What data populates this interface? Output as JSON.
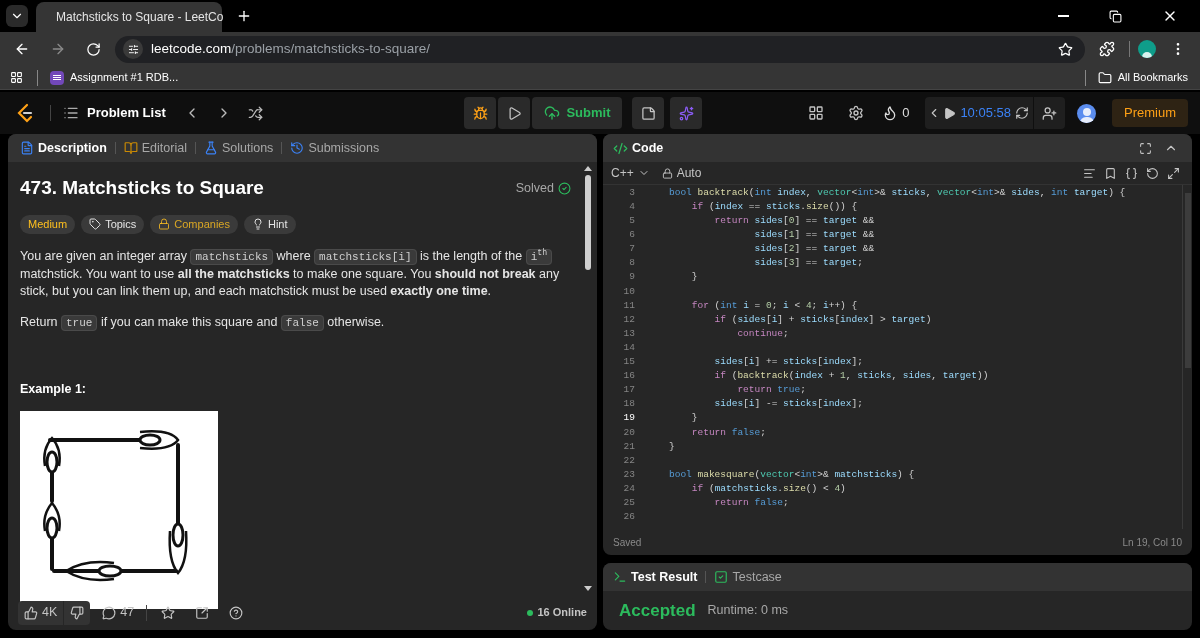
{
  "browser": {
    "tab_title": "Matchsticks to Square - LeetCo",
    "url_host": "leetcode.com",
    "url_path": "/problems/matchsticks-to-square/",
    "bookmarks": [
      "Assignment #1 RDB..."
    ],
    "all_bookmarks": "All Bookmarks"
  },
  "nav": {
    "problem_list": "Problem List",
    "submit": "Submit",
    "streak": "0",
    "timer": "10:05:58",
    "premium": "Premium"
  },
  "description": {
    "tabs": [
      {
        "label": "Description",
        "selected": true
      },
      {
        "label": "Editorial",
        "selected": false
      },
      {
        "label": "Solutions",
        "selected": false
      },
      {
        "label": "Submissions",
        "selected": false
      }
    ],
    "title": "473. Matchsticks to Square",
    "status": "Solved",
    "tags": [
      {
        "kind": "difficulty",
        "label": "Medium"
      },
      {
        "kind": "topics",
        "label": "Topics"
      },
      {
        "kind": "companies",
        "label": "Companies"
      },
      {
        "kind": "hint",
        "label": "Hint"
      }
    ],
    "paragraphs": [
      [
        {
          "kind": "text",
          "text": "You are given an integer array "
        },
        {
          "kind": "code",
          "text": "matchsticks"
        },
        {
          "kind": "text",
          "text": " where "
        },
        {
          "kind": "code",
          "text": "matchsticks[i]"
        },
        {
          "kind": "text",
          "text": " is the length of the "
        },
        {
          "kind": "code",
          "text": "i$^{th}$"
        },
        {
          "kind": "text",
          "text": " matchstick. You want to use **all the matchsticks** to make one square. You **should not break** any stick, but you can link them up, and each matchstick must be used **exactly one time**."
        }
      ],
      [
        {
          "kind": "text",
          "text": "Return "
        },
        {
          "kind": "code",
          "text": "true"
        },
        {
          "kind": "text",
          "text": " if you can make this square and "
        },
        {
          "kind": "code",
          "text": "false"
        },
        {
          "kind": "text",
          "text": " otherwise."
        }
      ]
    ],
    "example_heading": "Example 1:",
    "footer": {
      "likes": "4K",
      "comments": "47",
      "online": "16 Online"
    }
  },
  "editor": {
    "title": "Code",
    "language": "C++",
    "mode": "Auto",
    "saved": "Saved",
    "cursor": "Ln 19, Col 10",
    "lines": [
      {
        "number": "3",
        "current": false,
        "tokens": [
          {
            "kind": "type",
            "text": "bool "
          },
          {
            "kind": "func",
            "text": "backtrack"
          },
          {
            "kind": "plain",
            "text": "("
          },
          {
            "kind": "type",
            "text": "int "
          },
          {
            "kind": "var",
            "text": "index"
          },
          {
            "kind": "plain",
            "text": ", "
          },
          {
            "kind": "class",
            "text": "vector"
          },
          {
            "kind": "plain",
            "text": "<"
          },
          {
            "kind": "type",
            "text": "int"
          },
          {
            "kind": "plain",
            "text": ">& "
          },
          {
            "kind": "var",
            "text": "sticks"
          },
          {
            "kind": "plain",
            "text": ", "
          },
          {
            "kind": "class",
            "text": "vector"
          },
          {
            "kind": "plain",
            "text": "<"
          },
          {
            "kind": "type",
            "text": "int"
          },
          {
            "kind": "plain",
            "text": ">& "
          },
          {
            "kind": "var",
            "text": "sides"
          },
          {
            "kind": "plain",
            "text": ", "
          },
          {
            "kind": "type",
            "text": "int "
          },
          {
            "kind": "var",
            "text": "target"
          },
          {
            "kind": "plain",
            "text": ") {"
          }
        ]
      },
      {
        "number": "4",
        "current": false,
        "tokens": [
          {
            "kind": "keyword",
            "text": "    if"
          },
          {
            "kind": "plain",
            "text": " ("
          },
          {
            "kind": "var",
            "text": "index"
          },
          {
            "kind": "plain",
            "text": " == "
          },
          {
            "kind": "var",
            "text": "sticks"
          },
          {
            "kind": "plain",
            "text": "."
          },
          {
            "kind": "func",
            "text": "size"
          },
          {
            "kind": "plain",
            "text": "()) {"
          }
        ]
      },
      {
        "number": "5",
        "current": false,
        "tokens": [
          {
            "kind": "keyword",
            "text": "        return "
          },
          {
            "kind": "var",
            "text": "sides"
          },
          {
            "kind": "plain",
            "text": "["
          },
          {
            "kind": "number",
            "text": "0"
          },
          {
            "kind": "plain",
            "text": "] == "
          },
          {
            "kind": "var",
            "text": "target"
          },
          {
            "kind": "plain",
            "text": " &&"
          }
        ]
      },
      {
        "number": "6",
        "current": false,
        "tokens": [
          {
            "kind": "var",
            "text": "               sides"
          },
          {
            "kind": "plain",
            "text": "["
          },
          {
            "kind": "number",
            "text": "1"
          },
          {
            "kind": "plain",
            "text": "] == "
          },
          {
            "kind": "var",
            "text": "target"
          },
          {
            "kind": "plain",
            "text": " &&"
          }
        ]
      },
      {
        "number": "7",
        "current": false,
        "tokens": [
          {
            "kind": "var",
            "text": "               sides"
          },
          {
            "kind": "plain",
            "text": "["
          },
          {
            "kind": "number",
            "text": "2"
          },
          {
            "kind": "plain",
            "text": "] == "
          },
          {
            "kind": "var",
            "text": "target"
          },
          {
            "kind": "plain",
            "text": " &&"
          }
        ]
      },
      {
        "number": "8",
        "current": false,
        "tokens": [
          {
            "kind": "var",
            "text": "               sides"
          },
          {
            "kind": "plain",
            "text": "["
          },
          {
            "kind": "number",
            "text": "3"
          },
          {
            "kind": "plain",
            "text": "] == "
          },
          {
            "kind": "var",
            "text": "target"
          },
          {
            "kind": "plain",
            "text": ";"
          }
        ]
      },
      {
        "number": "9",
        "current": false,
        "tokens": [
          {
            "kind": "plain",
            "text": "    }"
          }
        ]
      },
      {
        "number": "10",
        "current": false
      },
      {
        "number": "11",
        "current": false,
        "tokens": [
          {
            "kind": "keyword",
            "text": "    for"
          },
          {
            "kind": "plain",
            "text": " ("
          },
          {
            "kind": "type",
            "text": "int "
          },
          {
            "kind": "var",
            "text": "i"
          },
          {
            "kind": "plain",
            "text": " = "
          },
          {
            "kind": "number",
            "text": "0"
          },
          {
            "kind": "plain",
            "text": "; "
          },
          {
            "kind": "var",
            "text": "i"
          },
          {
            "kind": "plain",
            "text": " < "
          },
          {
            "kind": "number",
            "text": "4"
          },
          {
            "kind": "plain",
            "text": "; "
          },
          {
            "kind": "var",
            "text": "i"
          },
          {
            "kind": "plain",
            "text": "++) {"
          }
        ]
      },
      {
        "number": "12",
        "current": false,
        "tokens": [
          {
            "kind": "keyword",
            "text": "        if"
          },
          {
            "kind": "plain",
            "text": " ("
          },
          {
            "kind": "var",
            "text": "sides"
          },
          {
            "kind": "plain",
            "text": "["
          },
          {
            "kind": "var",
            "text": "i"
          },
          {
            "kind": "plain",
            "text": "] + "
          },
          {
            "kind": "var",
            "text": "sticks"
          },
          {
            "kind": "plain",
            "text": "["
          },
          {
            "kind": "var",
            "text": "index"
          },
          {
            "kind": "plain",
            "text": "] > "
          },
          {
            "kind": "var",
            "text": "target"
          },
          {
            "kind": "plain",
            "text": ")"
          }
        ]
      },
      {
        "number": "13",
        "current": false,
        "tokens": [
          {
            "kind": "keyword",
            "text": "            continue"
          },
          {
            "kind": "plain",
            "text": ";"
          }
        ]
      },
      {
        "number": "14",
        "current": false
      },
      {
        "number": "15",
        "current": false,
        "tokens": [
          {
            "kind": "var",
            "text": "        sides"
          },
          {
            "kind": "plain",
            "text": "["
          },
          {
            "kind": "var",
            "text": "i"
          },
          {
            "kind": "plain",
            "text": "] += "
          },
          {
            "kind": "var",
            "text": "sticks"
          },
          {
            "kind": "plain",
            "text": "["
          },
          {
            "kind": "var",
            "text": "index"
          },
          {
            "kind": "plain",
            "text": "];"
          }
        ]
      },
      {
        "number": "16",
        "current": false,
        "tokens": [
          {
            "kind": "keyword",
            "text": "        if"
          },
          {
            "kind": "plain",
            "text": " ("
          },
          {
            "kind": "func",
            "text": "backtrack"
          },
          {
            "kind": "plain",
            "text": "("
          },
          {
            "kind": "var",
            "text": "index"
          },
          {
            "kind": "plain",
            "text": " + "
          },
          {
            "kind": "number",
            "text": "1"
          },
          {
            "kind": "plain",
            "text": ", "
          },
          {
            "kind": "var",
            "text": "sticks"
          },
          {
            "kind": "plain",
            "text": ", "
          },
          {
            "kind": "var",
            "text": "sides"
          },
          {
            "kind": "plain",
            "text": ", "
          },
          {
            "kind": "var",
            "text": "target"
          },
          {
            "kind": "plain",
            "text": "))"
          }
        ]
      },
      {
        "number": "17",
        "current": false,
        "tokens": [
          {
            "kind": "keyword",
            "text": "            return "
          },
          {
            "kind": "type",
            "text": "true"
          },
          {
            "kind": "plain",
            "text": ";"
          }
        ]
      },
      {
        "number": "18",
        "current": false,
        "tokens": [
          {
            "kind": "var",
            "text": "        sides"
          },
          {
            "kind": "plain",
            "text": "["
          },
          {
            "kind": "var",
            "text": "i"
          },
          {
            "kind": "plain",
            "text": "] -= "
          },
          {
            "kind": "var",
            "text": "sticks"
          },
          {
            "kind": "plain",
            "text": "["
          },
          {
            "kind": "var",
            "text": "index"
          },
          {
            "kind": "plain",
            "text": "];"
          }
        ]
      },
      {
        "number": "19",
        "current": true,
        "tokens": [
          {
            "kind": "plain",
            "text": "    }"
          }
        ]
      },
      {
        "number": "20",
        "current": false,
        "tokens": [
          {
            "kind": "keyword",
            "text": "    return "
          },
          {
            "kind": "type",
            "text": "false"
          },
          {
            "kind": "plain",
            "text": ";"
          }
        ]
      },
      {
        "number": "21",
        "current": false,
        "tokens": [
          {
            "kind": "plain",
            "text": "}"
          }
        ]
      },
      {
        "number": "22",
        "current": false
      },
      {
        "number": "23",
        "current": false,
        "tokens": [
          {
            "kind": "type",
            "text": "bool "
          },
          {
            "kind": "func",
            "text": "makesquare"
          },
          {
            "kind": "plain",
            "text": "("
          },
          {
            "kind": "class",
            "text": "vector"
          },
          {
            "kind": "plain",
            "text": "<"
          },
          {
            "kind": "type",
            "text": "int"
          },
          {
            "kind": "plain",
            "text": ">& "
          },
          {
            "kind": "var",
            "text": "matchsticks"
          },
          {
            "kind": "plain",
            "text": ") {"
          }
        ]
      },
      {
        "number": "24",
        "current": false,
        "tokens": [
          {
            "kind": "keyword",
            "text": "    if"
          },
          {
            "kind": "plain",
            "text": " ("
          },
          {
            "kind": "var",
            "text": "matchsticks"
          },
          {
            "kind": "plain",
            "text": "."
          },
          {
            "kind": "func",
            "text": "size"
          },
          {
            "kind": "plain",
            "text": "() < "
          },
          {
            "kind": "number",
            "text": "4"
          },
          {
            "kind": "plain",
            "text": ")"
          }
        ]
      },
      {
        "number": "25",
        "current": false,
        "tokens": [
          {
            "kind": "keyword",
            "text": "        return "
          },
          {
            "kind": "type",
            "text": "false"
          },
          {
            "kind": "plain",
            "text": ";"
          }
        ]
      },
      {
        "number": "26",
        "current": false
      }
    ]
  },
  "result": {
    "tabs": [
      {
        "label": "Test Result",
        "selected": true
      },
      {
        "label": "Testcase",
        "selected": false
      }
    ],
    "verdict": "Accepted",
    "runtime": "Runtime: 0 ms"
  }
}
